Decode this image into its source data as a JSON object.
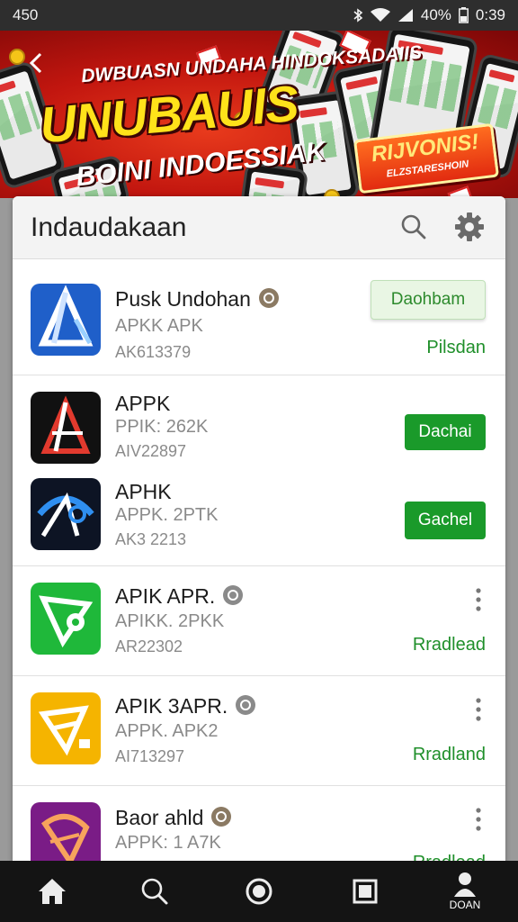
{
  "status_bar": {
    "time_left": "450",
    "battery": "40%",
    "clock": "0:39"
  },
  "banner": {
    "title_small": "DWBUASN UNDAHA HINDOKSADAIIS",
    "title_big": "UNUBAUIS",
    "subtitle": "BOINI INDOESSIAK",
    "badge_text": "RIJVONIS!",
    "badge_sub": "ELZSTARESHOIN"
  },
  "card": {
    "title": "Indaudakaan"
  },
  "apps": [
    {
      "name": "Pusk Undohan",
      "subtitle": "APKK APK",
      "meta": "AK613379",
      "button": "Daohbam",
      "status": "Pilsdan"
    },
    {
      "name": "APPK",
      "subtitle": "PPIK: 262K",
      "meta": "AIV22897",
      "button": "Dachai"
    },
    {
      "name": "APHK",
      "subtitle": "APPK. 2PTK",
      "meta": "AK3 2213",
      "button": "Gachel"
    },
    {
      "name": "APIK APR.",
      "subtitle": "APIKK. 2PKK",
      "meta": "AR22302",
      "status": "Rradlead"
    },
    {
      "name": "APIK 3APR.",
      "subtitle": "APPK. APK2",
      "meta": "AI713297",
      "status": "Rradland"
    },
    {
      "name": "Baor ahld",
      "subtitle": "APPK: 1 A7K",
      "status": "Rradlead"
    }
  ],
  "nav": {
    "profile_label": "DOAN"
  },
  "colors": {
    "accent_green": "#1a9a2a",
    "banner_red": "#c2160f",
    "title_yellow": "#ffe21a"
  }
}
